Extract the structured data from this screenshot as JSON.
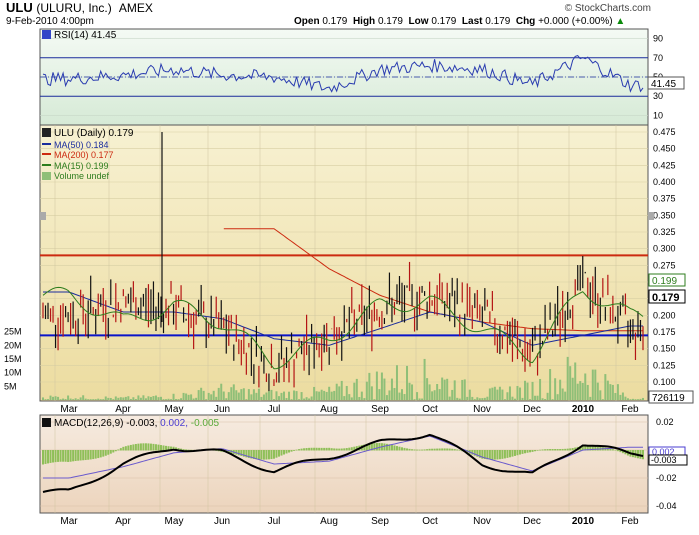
{
  "header": {
    "ticker": "ULU",
    "company": "(ULURU, Inc.)",
    "exchange": "AMEX",
    "datetime": "9-Feb-2010 4:00pm",
    "logo": "© StockCharts.com",
    "open_label": "Open",
    "open": "0.179",
    "high_label": "High",
    "high": "0.179",
    "low_label": "Low",
    "low": "0.179",
    "last_label": "Last",
    "last": "0.179",
    "chg_label": "Chg",
    "chg": "+0.000 (+0.00%)",
    "chg_arrow": "▲"
  },
  "rsi": {
    "legend": "RSI(14) 41.45",
    "value_label": "41.45",
    "ticks": [
      "90",
      "70",
      "50",
      "30",
      "10"
    ]
  },
  "price": {
    "legend": {
      "title": "ULU (Daily) 0.179",
      "ma50": "MA(50) 0.184",
      "ma200": "MA(200) 0.177",
      "ma15": "MA(15) 0.199",
      "volume": "Volume undef"
    },
    "price_ticks": [
      "0.475",
      "0.450",
      "0.425",
      "0.400",
      "0.375",
      "0.350",
      "0.325",
      "0.300",
      "0.275",
      "0.250",
      "0.225",
      "0.200",
      "0.175",
      "0.150",
      "0.125",
      "0.100"
    ],
    "volume_ticks": [
      "25M",
      "20M",
      "15M",
      "10M",
      "5M"
    ],
    "last_label": "0.179",
    "ma15_label": "0.199",
    "volume_label": "726119"
  },
  "macd": {
    "legend_prefix": "MACD(12,26,9)",
    "macd": "-0.003,",
    "signal": "0.002,",
    "hist": "-0.005",
    "ticks": [
      "0.02",
      "0.00",
      "-0.02",
      "-0.04"
    ],
    "signal_label": "0.002",
    "macd_label": "-0.003"
  },
  "x_axis": {
    "months": [
      "Mar",
      "Apr",
      "May",
      "Jun",
      "Jul",
      "Aug",
      "Sep",
      "Oct",
      "Nov",
      "Dec",
      "2010",
      "Feb"
    ]
  },
  "colors": {
    "rsi_bg": "#e6f2e6",
    "price_bg": "#f2e8ba",
    "macd_bg": "#f0dcc8",
    "up": "#111111",
    "down": "#b41414",
    "ma50": "#1a2c9c",
    "ma200": "#cc2a10",
    "ma15": "#2e7d1e",
    "volume": "#8fbf78",
    "resistance": "#cc2a10",
    "support": "#0a14c8"
  },
  "chart_data": [
    {
      "type": "line",
      "title": "RSI(14) 41.45",
      "ylim": [
        0,
        100
      ],
      "x": [
        "Mar",
        "Apr",
        "May",
        "Jun",
        "Jul",
        "Aug",
        "Sep",
        "Oct",
        "Nov",
        "Dec",
        "2010",
        "Feb"
      ],
      "series": [
        {
          "name": "RSI(14)",
          "values": [
            48,
            52,
            58,
            52,
            50,
            38,
            58,
            62,
            58,
            42,
            70,
            41.45
          ]
        }
      ]
    },
    {
      "type": "line",
      "title": "ULU (Daily) 0.179",
      "ylim": [
        0.1,
        0.475
      ],
      "x": [
        "Mar",
        "Apr",
        "May",
        "Jun",
        "Jul",
        "Aug",
        "Sep",
        "Oct",
        "Nov",
        "Dec",
        "2010",
        "Feb"
      ],
      "series": [
        {
          "name": "ULU (Daily)",
          "values": [
            0.2,
            0.22,
            0.21,
            0.18,
            0.12,
            0.17,
            0.21,
            0.23,
            0.2,
            0.14,
            0.25,
            0.179
          ]
        },
        {
          "name": "MA(50)",
          "values": [
            0.235,
            0.205,
            0.205,
            0.195,
            0.165,
            0.155,
            0.18,
            0.205,
            0.19,
            0.155,
            0.17,
            0.184
          ]
        },
        {
          "name": "MA(200)",
          "values": [
            null,
            null,
            null,
            null,
            0.33,
            0.27,
            0.23,
            0.205,
            0.19,
            0.18,
            0.177,
            0.177
          ]
        },
        {
          "name": "MA(15)",
          "values": [
            0.23,
            0.19,
            0.215,
            0.19,
            0.13,
            0.165,
            0.215,
            0.22,
            0.18,
            0.14,
            0.24,
            0.199
          ]
        }
      ]
    },
    {
      "type": "bar",
      "title": "Volume undef",
      "categories": [
        "Mar",
        "Apr",
        "May",
        "Jun",
        "Jul",
        "Aug",
        "Sep",
        "Oct",
        "Nov",
        "Dec",
        "2010",
        "Feb"
      ],
      "series": [
        {
          "name": "Volume",
          "values": [
            1.5,
            1,
            2,
            5,
            3,
            4,
            10,
            12,
            3,
            6,
            16,
            0.73
          ]
        }
      ]
    },
    {
      "type": "line",
      "title": "MACD(12,26,9) -0.003, 0.002, -0.005",
      "ylim": [
        -0.045,
        0.025
      ],
      "x": [
        "Mar",
        "Apr",
        "May",
        "Jun",
        "Jul",
        "Aug",
        "Sep",
        "Oct",
        "Nov",
        "Dec",
        "2010",
        "Feb"
      ],
      "series": [
        {
          "name": "MACD",
          "values": [
            -0.03,
            -0.01,
            0.002,
            -0.002,
            -0.015,
            -0.005,
            0.005,
            0.012,
            -0.01,
            -0.018,
            0.005,
            -0.003
          ]
        },
        {
          "name": "Signal",
          "values": [
            -0.02,
            -0.012,
            -0.002,
            0.001,
            -0.01,
            -0.008,
            0.002,
            0.01,
            -0.005,
            -0.015,
            0.0,
            0.002
          ]
        },
        {
          "name": "Histogram",
          "values": [
            -0.01,
            0.002,
            0.004,
            -0.003,
            -0.005,
            0.003,
            0.003,
            0.002,
            -0.005,
            -0.003,
            0.005,
            -0.005
          ]
        }
      ]
    }
  ]
}
